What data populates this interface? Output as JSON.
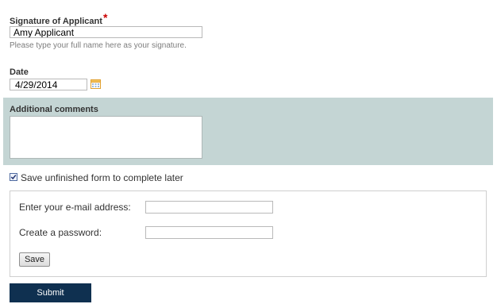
{
  "signature": {
    "label": "Signature of Applicant",
    "required_mark": "*",
    "value": "Amy Applicant",
    "help": "Please type your full name here as your signature."
  },
  "date": {
    "label": "Date",
    "value": "4/29/2014",
    "icon": "calendar-icon"
  },
  "comments": {
    "label": "Additional comments",
    "value": ""
  },
  "save_later": {
    "checked": true,
    "label": "Save unfinished form to complete later",
    "email_label": "Enter your e-mail address:",
    "email_value": "",
    "password_label": "Create a password:",
    "password_value": "",
    "save_button_label": "Save"
  },
  "submit": {
    "label": "Submit"
  },
  "colors": {
    "comments_band": "#c4d5d4",
    "submit_button": "#0f3050",
    "required_mark": "#cc0000"
  }
}
